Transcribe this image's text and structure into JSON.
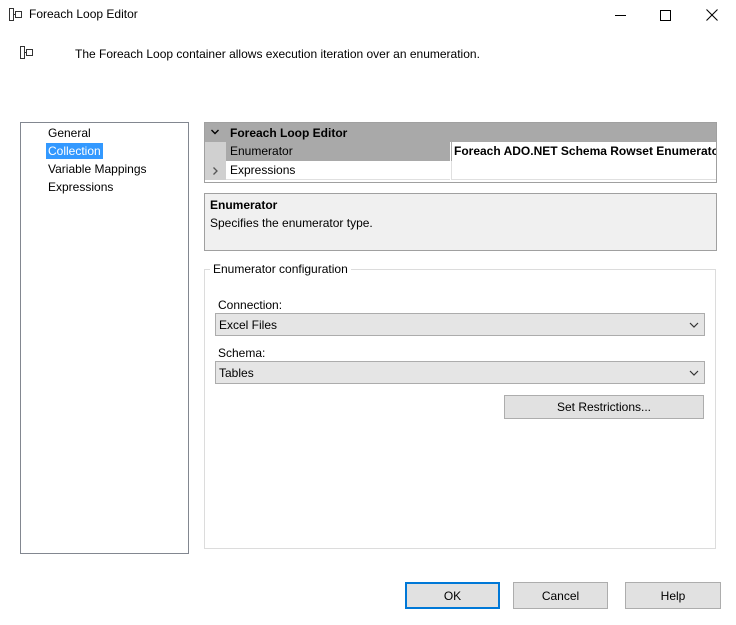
{
  "window": {
    "title": "Foreach Loop Editor"
  },
  "header": {
    "description": "The Foreach Loop container allows execution iteration over an enumeration."
  },
  "nav": {
    "items": [
      {
        "label": "General",
        "selected": false
      },
      {
        "label": "Collection",
        "selected": true
      },
      {
        "label": "Variable Mappings",
        "selected": false
      },
      {
        "label": "Expressions",
        "selected": false
      }
    ]
  },
  "property_grid": {
    "category": "Foreach Loop Editor",
    "rows": [
      {
        "name": "Enumerator",
        "value": "Foreach ADO.NET Schema Rowset Enumerator"
      },
      {
        "name": "Expressions",
        "value": ""
      }
    ]
  },
  "description_panel": {
    "title": "Enumerator",
    "text": "Specifies the enumerator type."
  },
  "enumerator_config": {
    "group_label": "Enumerator configuration",
    "connection_label": "Connection:",
    "connection_value": "Excel Files",
    "schema_label": "Schema:",
    "schema_value": "Tables",
    "restrictions_button": "Set Restrictions..."
  },
  "footer": {
    "ok": "OK",
    "cancel": "Cancel",
    "help": "Help"
  },
  "colors": {
    "selection": "#3399ff",
    "category_bg": "#a9a9a9",
    "default_button_border": "#0078d7"
  }
}
